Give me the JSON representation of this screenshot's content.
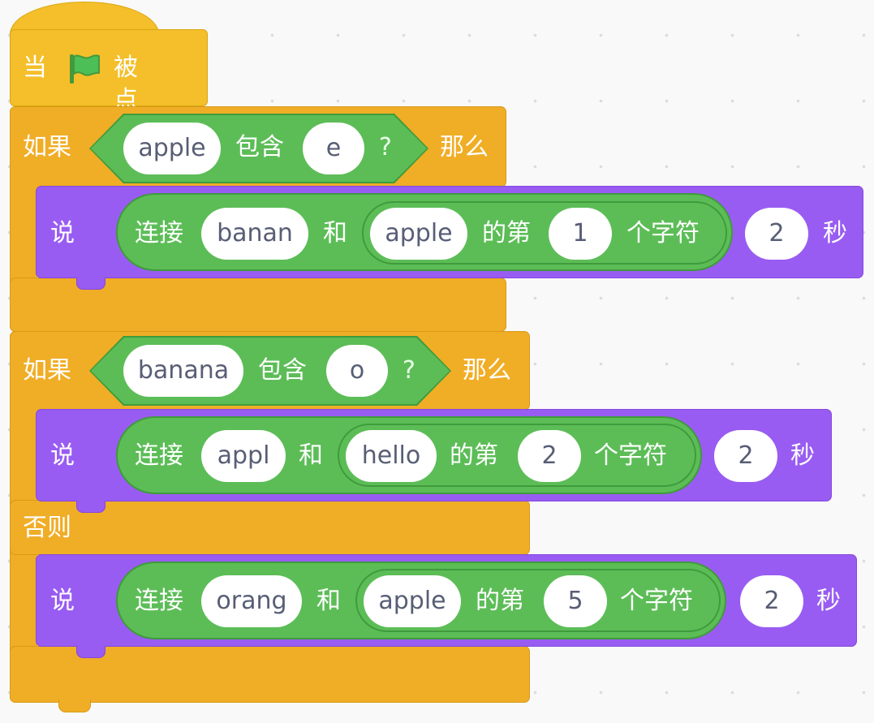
{
  "hat": {
    "prefix": "当",
    "suffix": "被点击"
  },
  "if1": {
    "if_label": "如果",
    "condition": {
      "text": "apple",
      "op": "包含",
      "sub": "e",
      "q": "?"
    },
    "then_label": "那么",
    "say": {
      "label": "说",
      "join_label": "连接",
      "join_a": "banan",
      "and": "和",
      "letter_string": "apple",
      "letter_of": "的第",
      "letter_index": "1",
      "letter_unit": "个字符",
      "seconds": "2",
      "seconds_unit": "秒"
    }
  },
  "if2": {
    "if_label": "如果",
    "condition": {
      "text": "banana",
      "op": "包含",
      "sub": "o",
      "q": "?"
    },
    "then_label": "那么",
    "say": {
      "label": "说",
      "join_label": "连接",
      "join_a": "appl",
      "and": "和",
      "letter_string": "hello",
      "letter_of": "的第",
      "letter_index": "2",
      "letter_unit": "个字符",
      "seconds": "2",
      "seconds_unit": "秒"
    },
    "else_label": "否则",
    "else_say": {
      "label": "说",
      "join_label": "连接",
      "join_a": "orang",
      "and": "和",
      "letter_string": "apple",
      "letter_of": "的第",
      "letter_index": "5",
      "letter_unit": "个字符",
      "seconds": "2",
      "seconds_unit": "秒"
    }
  },
  "colors": {
    "events": "#f4bf2a",
    "control": "#f0ad26",
    "looks": "#995cf2",
    "operators": "#5cbd57",
    "flag": "#4cbf56"
  },
  "icons": {
    "flag": "green-flag-icon"
  }
}
